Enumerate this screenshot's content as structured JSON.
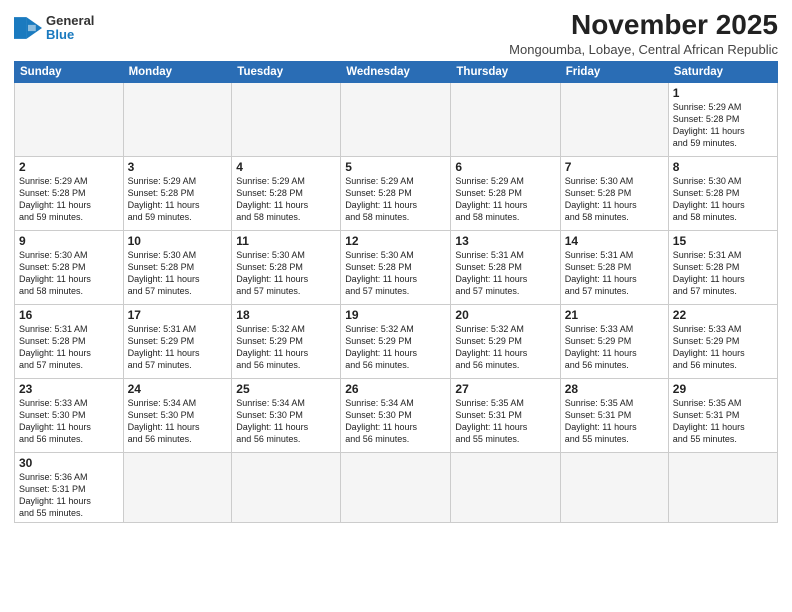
{
  "logo": {
    "line1": "General",
    "line2": "Blue"
  },
  "title": "November 2025",
  "subtitle": "Mongoumba, Lobaye, Central African Republic",
  "days_of_week": [
    "Sunday",
    "Monday",
    "Tuesday",
    "Wednesday",
    "Thursday",
    "Friday",
    "Saturday"
  ],
  "weeks": [
    [
      {
        "day": "",
        "info": ""
      },
      {
        "day": "",
        "info": ""
      },
      {
        "day": "",
        "info": ""
      },
      {
        "day": "",
        "info": ""
      },
      {
        "day": "",
        "info": ""
      },
      {
        "day": "",
        "info": ""
      },
      {
        "day": "1",
        "info": "Sunrise: 5:29 AM\nSunset: 5:28 PM\nDaylight: 11 hours\nand 59 minutes."
      }
    ],
    [
      {
        "day": "2",
        "info": "Sunrise: 5:29 AM\nSunset: 5:28 PM\nDaylight: 11 hours\nand 59 minutes."
      },
      {
        "day": "3",
        "info": "Sunrise: 5:29 AM\nSunset: 5:28 PM\nDaylight: 11 hours\nand 59 minutes."
      },
      {
        "day": "4",
        "info": "Sunrise: 5:29 AM\nSunset: 5:28 PM\nDaylight: 11 hours\nand 58 minutes."
      },
      {
        "day": "5",
        "info": "Sunrise: 5:29 AM\nSunset: 5:28 PM\nDaylight: 11 hours\nand 58 minutes."
      },
      {
        "day": "6",
        "info": "Sunrise: 5:29 AM\nSunset: 5:28 PM\nDaylight: 11 hours\nand 58 minutes."
      },
      {
        "day": "7",
        "info": "Sunrise: 5:30 AM\nSunset: 5:28 PM\nDaylight: 11 hours\nand 58 minutes."
      },
      {
        "day": "8",
        "info": "Sunrise: 5:30 AM\nSunset: 5:28 PM\nDaylight: 11 hours\nand 58 minutes."
      }
    ],
    [
      {
        "day": "9",
        "info": "Sunrise: 5:30 AM\nSunset: 5:28 PM\nDaylight: 11 hours\nand 58 minutes."
      },
      {
        "day": "10",
        "info": "Sunrise: 5:30 AM\nSunset: 5:28 PM\nDaylight: 11 hours\nand 57 minutes."
      },
      {
        "day": "11",
        "info": "Sunrise: 5:30 AM\nSunset: 5:28 PM\nDaylight: 11 hours\nand 57 minutes."
      },
      {
        "day": "12",
        "info": "Sunrise: 5:30 AM\nSunset: 5:28 PM\nDaylight: 11 hours\nand 57 minutes."
      },
      {
        "day": "13",
        "info": "Sunrise: 5:31 AM\nSunset: 5:28 PM\nDaylight: 11 hours\nand 57 minutes."
      },
      {
        "day": "14",
        "info": "Sunrise: 5:31 AM\nSunset: 5:28 PM\nDaylight: 11 hours\nand 57 minutes."
      },
      {
        "day": "15",
        "info": "Sunrise: 5:31 AM\nSunset: 5:28 PM\nDaylight: 11 hours\nand 57 minutes."
      }
    ],
    [
      {
        "day": "16",
        "info": "Sunrise: 5:31 AM\nSunset: 5:28 PM\nDaylight: 11 hours\nand 57 minutes."
      },
      {
        "day": "17",
        "info": "Sunrise: 5:31 AM\nSunset: 5:29 PM\nDaylight: 11 hours\nand 57 minutes."
      },
      {
        "day": "18",
        "info": "Sunrise: 5:32 AM\nSunset: 5:29 PM\nDaylight: 11 hours\nand 56 minutes."
      },
      {
        "day": "19",
        "info": "Sunrise: 5:32 AM\nSunset: 5:29 PM\nDaylight: 11 hours\nand 56 minutes."
      },
      {
        "day": "20",
        "info": "Sunrise: 5:32 AM\nSunset: 5:29 PM\nDaylight: 11 hours\nand 56 minutes."
      },
      {
        "day": "21",
        "info": "Sunrise: 5:33 AM\nSunset: 5:29 PM\nDaylight: 11 hours\nand 56 minutes."
      },
      {
        "day": "22",
        "info": "Sunrise: 5:33 AM\nSunset: 5:29 PM\nDaylight: 11 hours\nand 56 minutes."
      }
    ],
    [
      {
        "day": "23",
        "info": "Sunrise: 5:33 AM\nSunset: 5:30 PM\nDaylight: 11 hours\nand 56 minutes."
      },
      {
        "day": "24",
        "info": "Sunrise: 5:34 AM\nSunset: 5:30 PM\nDaylight: 11 hours\nand 56 minutes."
      },
      {
        "day": "25",
        "info": "Sunrise: 5:34 AM\nSunset: 5:30 PM\nDaylight: 11 hours\nand 56 minutes."
      },
      {
        "day": "26",
        "info": "Sunrise: 5:34 AM\nSunset: 5:30 PM\nDaylight: 11 hours\nand 56 minutes."
      },
      {
        "day": "27",
        "info": "Sunrise: 5:35 AM\nSunset: 5:31 PM\nDaylight: 11 hours\nand 55 minutes."
      },
      {
        "day": "28",
        "info": "Sunrise: 5:35 AM\nSunset: 5:31 PM\nDaylight: 11 hours\nand 55 minutes."
      },
      {
        "day": "29",
        "info": "Sunrise: 5:35 AM\nSunset: 5:31 PM\nDaylight: 11 hours\nand 55 minutes."
      }
    ],
    [
      {
        "day": "30",
        "info": "Sunrise: 5:36 AM\nSunset: 5:31 PM\nDaylight: 11 hours\nand 55 minutes."
      },
      {
        "day": "",
        "info": ""
      },
      {
        "day": "",
        "info": ""
      },
      {
        "day": "",
        "info": ""
      },
      {
        "day": "",
        "info": ""
      },
      {
        "day": "",
        "info": ""
      },
      {
        "day": "",
        "info": ""
      }
    ]
  ]
}
